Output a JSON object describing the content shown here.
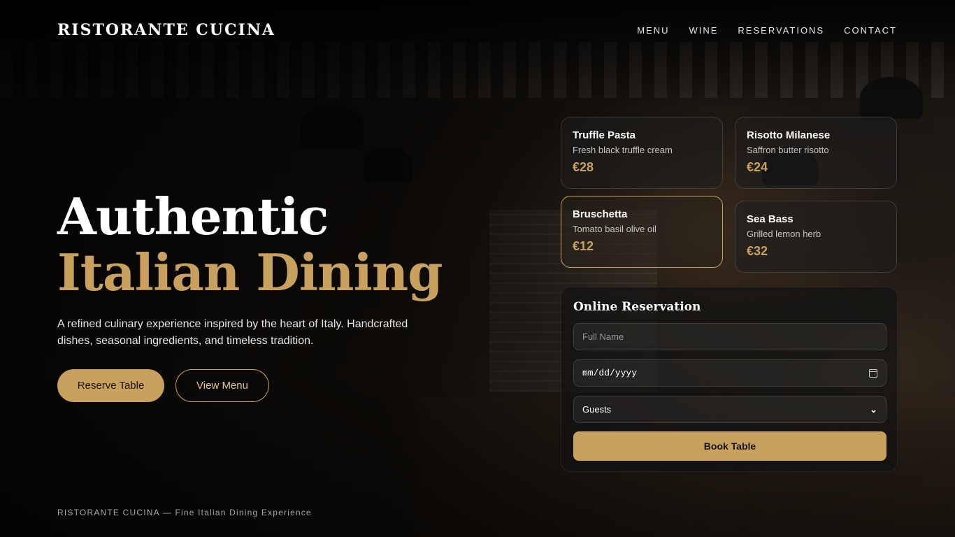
{
  "brand": "RISTORANTE CUCINA",
  "nav": [
    "MENU",
    "WINE",
    "RESERVATIONS",
    "CONTACT"
  ],
  "hero": {
    "title_line1": "Authentic",
    "title_line2": "Italian Dining",
    "description": "A refined culinary experience inspired by the heart of Italy. Handcrafted dishes, seasonal ingredients, and timeless tradition.",
    "primary_button": "Reserve Table",
    "secondary_button": "View Menu"
  },
  "menu_cards": [
    {
      "name": "Truffle Pasta",
      "desc": "Fresh black truffle cream",
      "price": "€28"
    },
    {
      "name": "Risotto Milanese",
      "desc": "Saffron butter risotto",
      "price": "€24"
    },
    {
      "name": "Bruschetta",
      "desc": "Tomato basil olive oil",
      "price": "€12"
    },
    {
      "name": "Sea Bass",
      "desc": "Grilled lemon herb",
      "price": "€32"
    }
  ],
  "reservation": {
    "title": "Online Reservation",
    "name_placeholder": "Full Name",
    "date_value": "mm/dd/yyyy",
    "guests_value": "Guests",
    "submit": "Book Table"
  },
  "footer": "RISTORANTE CUCINA — Fine Italian Dining Experience",
  "colors": {
    "accent": "#c9a15e",
    "background": "#0d0b09"
  }
}
